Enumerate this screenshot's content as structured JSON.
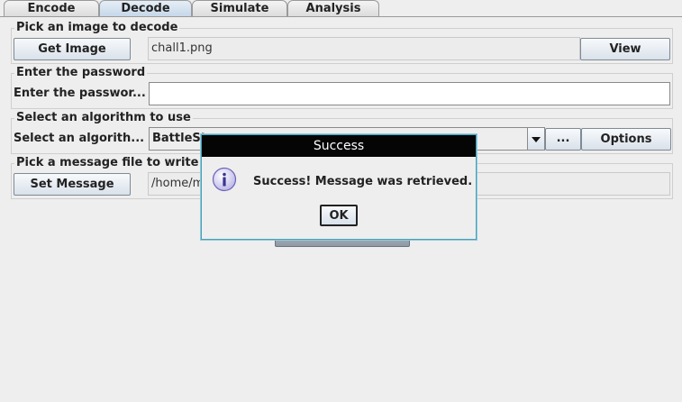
{
  "tabs": [
    "Encode",
    "Decode",
    "Simulate",
    "Analysis"
  ],
  "image_section": {
    "legend": "Pick an image to decode",
    "get_image_label": "Get Image",
    "filename": "chall1.png",
    "view_label": "View"
  },
  "password_section": {
    "legend": "Enter the password",
    "label": "Enter the passwor...",
    "value": ""
  },
  "algorithm_section": {
    "legend": "Select an algorithm to use",
    "label": "Select an algorith...",
    "selected": "BattleSt",
    "dots_label": "...",
    "options_label": "Options"
  },
  "message_section": {
    "legend": "Pick a message file to write t",
    "set_message_label": "Set Message",
    "path": "/home/my"
  },
  "dialog": {
    "title": "Success",
    "message": "Success! Message was retrieved.",
    "ok_label": "OK"
  }
}
